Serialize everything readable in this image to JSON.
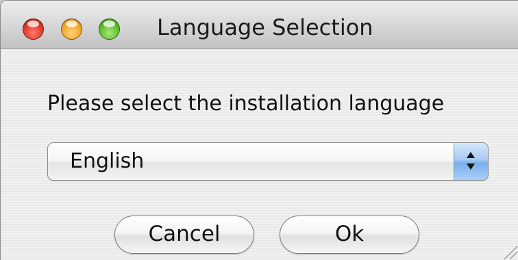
{
  "window": {
    "title": "Language Selection",
    "controls": {
      "close_icon": "close-icon",
      "minimize_icon": "minimize-icon",
      "zoom_icon": "zoom-icon",
      "colors": {
        "close": "#e0392b",
        "minimize": "#f2a72b",
        "zoom": "#5fbf2e"
      }
    }
  },
  "dialog": {
    "prompt": "Please select the installation language",
    "language_select": {
      "selected_value": "English",
      "stepper_icon": "updown-arrows-icon"
    },
    "buttons": {
      "cancel_label": "Cancel",
      "ok_label": "Ok"
    },
    "accent_color": "#79aeea"
  }
}
